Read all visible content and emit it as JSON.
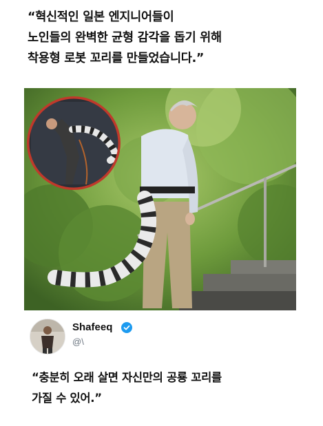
{
  "headline": {
    "line1": "“혁신적인 일본 엔지니어들이",
    "line2": "노인들의 완벽한 균형 감각을 돕기 위해",
    "line3": "착용형 로봇 꼬리를 만들었습니다.”"
  },
  "photo": {
    "description_icon": "photo-robot-tail-icon"
  },
  "tweet": {
    "user_name": "Shafeeq",
    "handle": "@\\",
    "verified_icon": "verified-badge-icon",
    "verified_color": "#1d9bf0"
  },
  "quote": {
    "line1": "“충분히 오래 살면 자신만의 공룡 꼬리를",
    "line2": "가질 수 있어.”"
  }
}
